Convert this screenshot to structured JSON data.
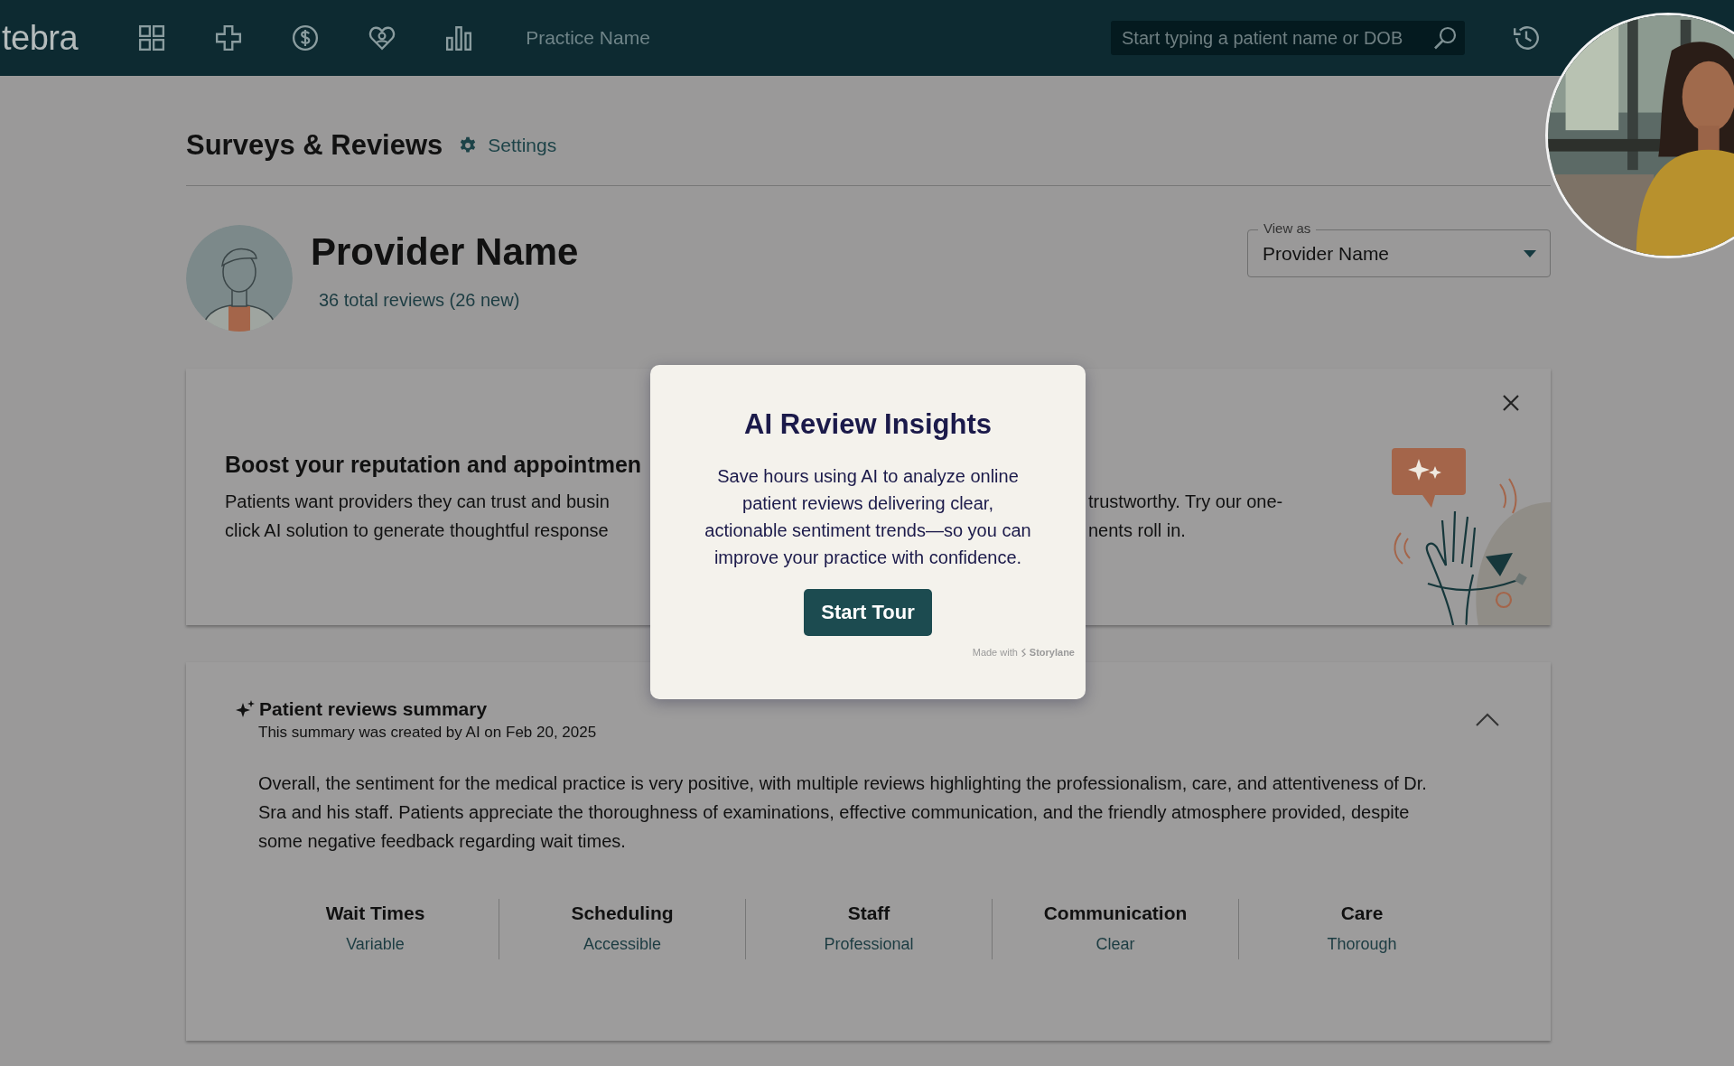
{
  "nav": {
    "logo": "tebra",
    "practice": "Practice Name",
    "search": {
      "placeholder": "Start typing a patient name or DOB"
    }
  },
  "header": {
    "title": "Surveys & Reviews",
    "settings": "Settings"
  },
  "provider": {
    "name": "Provider Name",
    "reviews": "36 total reviews (26 new)"
  },
  "view_as": {
    "label": "View as",
    "value": "Provider Name"
  },
  "banner": {
    "heading": "Boost your reputation and appointmen",
    "left_lines": [
      "Patients want providers they can trust and busin",
      "click AI solution to generate thoughtful response"
    ],
    "right_lines": [
      "trustworthy. Try our one-",
      "nents roll in."
    ]
  },
  "summary": {
    "title": "Patient reviews summary",
    "subtitle": "This summary was created by AI on Feb 20, 2025",
    "expanded": true,
    "text": "Overall, the sentiment for the medical practice is very positive, with multiple reviews highlighting the professionalism, care, and attentiveness of Dr. Sra and his staff. Patients appreciate the thoroughness of examinations, effective communication, and the friendly atmosphere provided, despite some negative feedback regarding wait times.",
    "categories": [
      {
        "name": "Wait Times",
        "value": "Variable"
      },
      {
        "name": "Scheduling",
        "value": "Accessible"
      },
      {
        "name": "Staff",
        "value": "Professional"
      },
      {
        "name": "Communication",
        "value": "Clear"
      },
      {
        "name": "Care",
        "value": "Thorough"
      }
    ]
  },
  "modal": {
    "title": "AI Review Insights",
    "body": "Save hours using AI to analyze online patient reviews delivering clear, actionable sentiment trends—so you can improve your practice with confidence.",
    "button": "Start Tour",
    "footer_prefix": "Made with",
    "footer_brand": "Storylane"
  }
}
